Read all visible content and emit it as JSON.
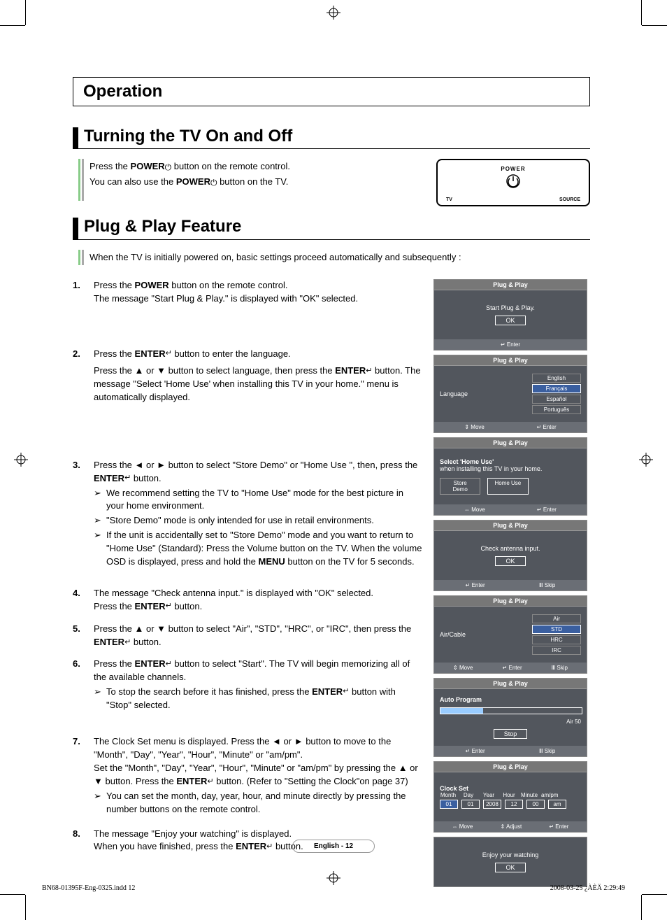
{
  "header": {
    "operation": "Operation"
  },
  "section1": {
    "title": "Turning the TV On and Off",
    "line1_a": "Press the ",
    "line1_b": "POWER",
    "line1_c": " button on the remote control.",
    "line2_a": "You can also use the ",
    "line2_b": "POWER",
    "line2_c": " button on the TV."
  },
  "remote": {
    "power": "POWER",
    "tv": "TV",
    "source": "SOURCE"
  },
  "section2": {
    "title": "Plug & Play Feature",
    "intro": "When the TV is initially powered on, basic settings proceed automatically and subsequently :",
    "steps": [
      {
        "n": "1.",
        "parts": [
          "Press the ",
          "POWER",
          " button on the remote control.\nThe message \"Start Plug & Play.\" is displayed with \"OK\" selected."
        ]
      },
      {
        "n": "2.",
        "parts": [
          "Press the ",
          "ENTER",
          " button to enter the language."
        ],
        "sub_parts": [
          "Press the ▲ or ▼ button to select language, then press the ",
          "ENTER",
          " button. The message \"Select 'Home Use' when installing this TV in your home.\" menu is automatically displayed."
        ]
      },
      {
        "n": "3.",
        "parts": [
          "Press the ◄ or ► button to select \"Store Demo\" or \"Home Use \", then, press the ",
          "ENTER",
          " button."
        ],
        "bullets": [
          "We recommend setting the TV to \"Home Use\" mode for the best picture in your home environment.",
          "\"Store Demo\" mode is only intended for use in retail environments.",
          "If the unit is accidentally set to \"Store Demo\" mode and you want to return to \"Home Use\" (Standard): Press the Volume button on the TV. When the volume OSD is displayed, press and hold the MENU button on the TV for 5 seconds."
        ],
        "bullet2_bold": "MENU"
      },
      {
        "n": "4.",
        "parts": [
          "The message \"Check antenna input.\" is displayed with \"OK\" selected.\nPress the ",
          "ENTER",
          " button."
        ]
      },
      {
        "n": "5.",
        "parts": [
          "Press the ▲ or ▼ button to select \"Air\", \"STD\", \"HRC\", or \"IRC\", then press the ",
          "ENTER",
          " button."
        ]
      },
      {
        "n": "6.",
        "parts": [
          "Press the ",
          "ENTER",
          " button to select \"Start\". The TV will begin memorizing all of the available channels."
        ],
        "bullets": [
          "To stop the search before it has finished, press the ENTER button with \"Stop\" selected."
        ],
        "bullet_bold": "ENTER"
      },
      {
        "n": "7.",
        "parts": [
          "The Clock Set menu is displayed. Press the ◄ or ► button to move to the \"Month\", \"Day\", \"Year\", \"Hour\", \"Minute\" or \"am/pm\".\nSet the \"Month\", \"Day\", \"Year\", \"Hour\", \"Minute\" or \"am/pm\" by pressing the ▲ or ▼ button. Press the ",
          "ENTER",
          " button. (Refer to \"Setting the Clock\"on page 37)"
        ],
        "bullets": [
          "You can set the month, day, year, hour, and minute directly by pressing the number buttons on the remote control."
        ]
      },
      {
        "n": "8.",
        "parts": [
          "The message \"Enjoy your watching\" is displayed.\nWhen you have finished, press the ",
          "ENTER",
          " button."
        ]
      }
    ]
  },
  "osd": {
    "pp": "Plug & Play",
    "s1": {
      "msg": "Start Plug & Play.",
      "ok": "OK",
      "foot": "Enter"
    },
    "s2": {
      "label": "Language",
      "opts": [
        "English",
        "Français",
        "Español",
        "Português"
      ],
      "sel": 1,
      "foot_l": "Move",
      "foot_r": "Enter"
    },
    "s3": {
      "msg1": "Select 'Home Use'",
      "msg2": "when installing this TV in your home.",
      "left": "Store Demo",
      "right": "Home Use",
      "foot_l": "Move",
      "foot_r": "Enter"
    },
    "s4": {
      "msg": "Check antenna input.",
      "ok": "OK",
      "foot_l": "Enter",
      "foot_r": "Skip"
    },
    "s5": {
      "label": "Air/Cable",
      "opts": [
        "Air",
        "STD",
        "HRC",
        "IRC"
      ],
      "sel": 1,
      "foot_l": "Move",
      "foot_c": "Enter",
      "foot_r": "Skip"
    },
    "s6": {
      "title": "Auto Program",
      "label": "Air",
      "val": "50",
      "stop": "Stop",
      "foot_l": "Enter",
      "foot_r": "Skip"
    },
    "s7": {
      "title": "Clock Set",
      "heads": [
        "Month",
        "Day",
        "Year",
        "Hour",
        "Minute",
        "am/pm"
      ],
      "vals": [
        "01",
        "01",
        "2008",
        "12",
        "00",
        "am"
      ],
      "foot_l": "Move",
      "foot_c": "Adjust",
      "foot_r": "Enter"
    },
    "s8": {
      "msg": "Enjoy your watching",
      "ok": "OK"
    }
  },
  "footer": {
    "page": "English - 12",
    "file": "BN68-01395F-Eng-0325.indd   12",
    "date": "2008-03-25   ¿ÀÈÄ 2:29:49"
  }
}
